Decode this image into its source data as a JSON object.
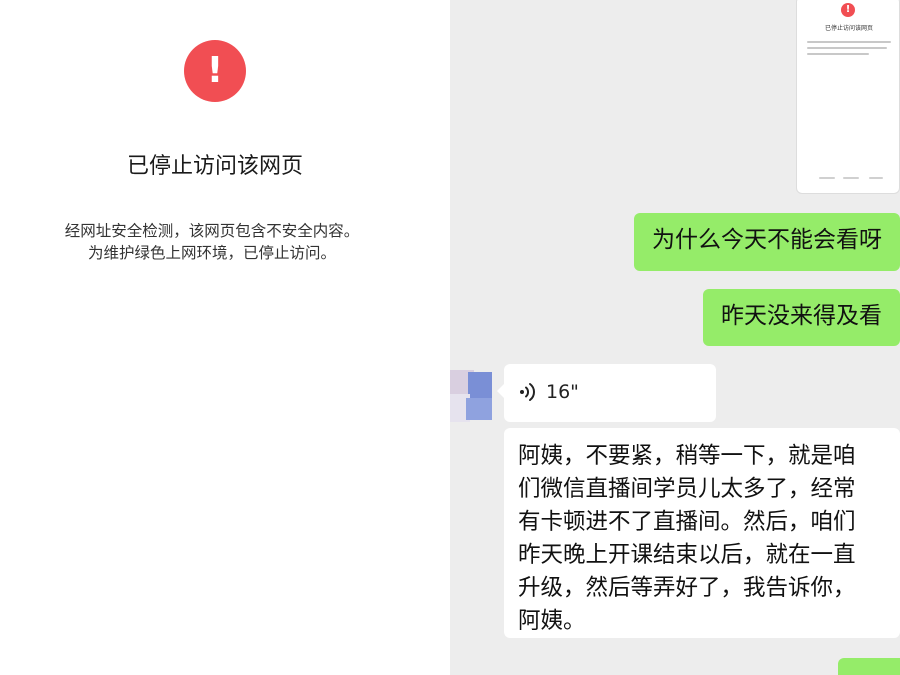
{
  "blocked_page": {
    "alert_icon": "exclamation-circle-icon",
    "alert_glyph": "!",
    "title": "已停止访问该网页",
    "desc_line1": "经网址安全检测，该网页包含不安全内容。",
    "desc_line2": "为维护绿色上网环境，已停止访问。",
    "accent_color": "#f14e53"
  },
  "chat": {
    "messages": [
      {
        "side": "right",
        "type": "text",
        "text": "为什么今天不能会看呀"
      },
      {
        "side": "right",
        "type": "text",
        "text": "昨天没来得及看"
      },
      {
        "side": "left",
        "type": "voice",
        "icon": "voice-wave-icon",
        "duration": "16\""
      },
      {
        "side": "left",
        "type": "text",
        "lines": [
          "阿姨，不要紧，稍等一下，就是咱",
          "们微信直播间学员儿太多了，经常",
          "有卡顿进不了直播间。然后，咱们",
          "昨天晚上开课结束以后，就在一直",
          "升级，然后等弄好了，我告诉你，",
          "阿姨。"
        ]
      }
    ],
    "bubble_green": "#95ec69",
    "background": "#ededed"
  },
  "thumbnail": {
    "title": "已停止访问该网页"
  }
}
